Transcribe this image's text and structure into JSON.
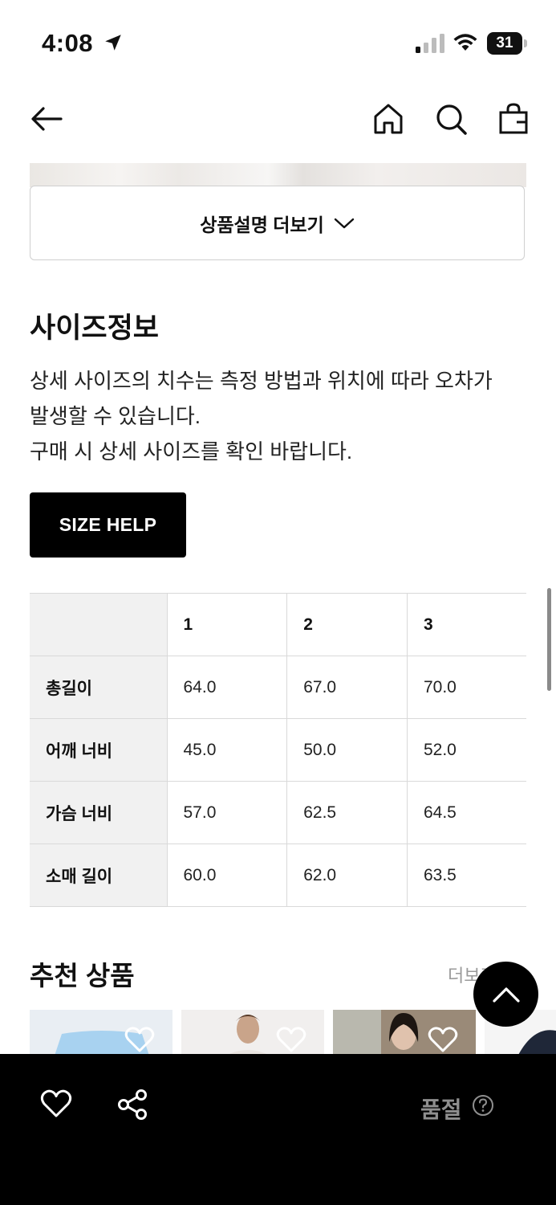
{
  "status_bar": {
    "time": "4:08",
    "battery": "31"
  },
  "product": {
    "more_description_label": "상품설명 더보기"
  },
  "size_info": {
    "title": "사이즈정보",
    "description_lines": [
      "상세 사이즈의 치수는 측정 방법과 위치에 따라 오차가",
      "발생할 수 있습니다.",
      "구매 시 상세 사이즈를 확인 바랍니다."
    ],
    "size_help_label": "SIZE HELP",
    "table": {
      "columns": [
        "1",
        "2",
        "3"
      ],
      "rows": [
        {
          "label": "총길이",
          "values": [
            "64.0",
            "67.0",
            "70.0"
          ]
        },
        {
          "label": "어깨 너비",
          "values": [
            "45.0",
            "50.0",
            "52.0"
          ]
        },
        {
          "label": "가슴 너비",
          "values": [
            "57.0",
            "62.5",
            "64.5"
          ]
        },
        {
          "label": "소매 길이",
          "values": [
            "60.0",
            "62.0",
            "63.5"
          ]
        }
      ]
    }
  },
  "recommended": {
    "title": "추천 상품",
    "more_label": "더보기"
  },
  "bottom_bar": {
    "status_label": "품절"
  },
  "icons": {
    "back": "back-arrow-icon",
    "home": "home-icon",
    "search": "search-icon",
    "bag": "shopping-bag-icon",
    "heart": "heart-icon",
    "share": "share-icon",
    "help": "question-circle-icon",
    "top": "chevron-up-icon"
  }
}
